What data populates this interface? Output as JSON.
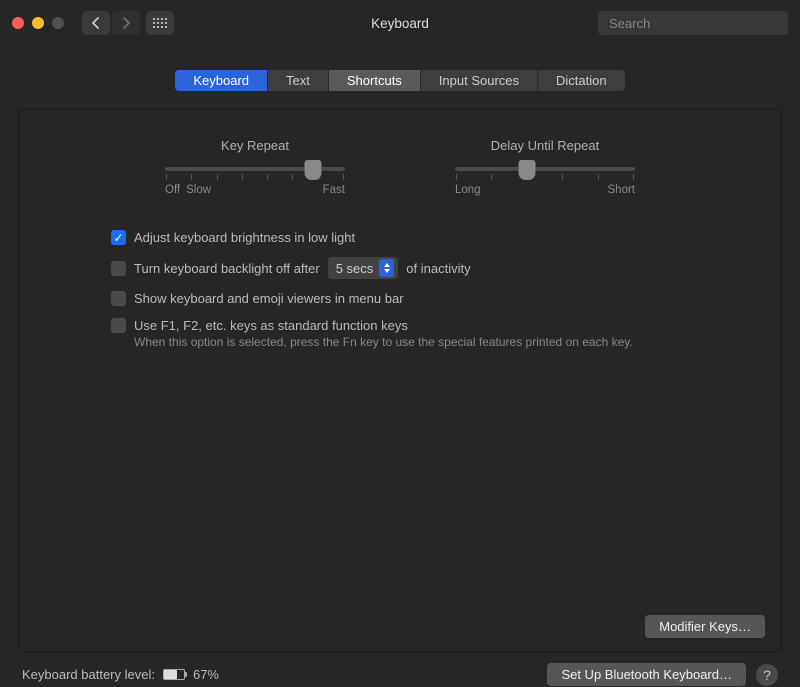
{
  "window": {
    "title": "Keyboard"
  },
  "search": {
    "placeholder": "Search"
  },
  "tabs": {
    "keyboard": "Keyboard",
    "text": "Text",
    "shortcuts": "Shortcuts",
    "input_sources": "Input Sources",
    "dictation": "Dictation"
  },
  "sliders": {
    "key_repeat": {
      "label": "Key Repeat",
      "left": "Off",
      "left2": "Slow",
      "right": "Fast",
      "position_pct": 82
    },
    "delay_repeat": {
      "label": "Delay Until Repeat",
      "left": "Long",
      "right": "Short",
      "position_pct": 40
    }
  },
  "options": {
    "brightness": {
      "checked": true,
      "label": "Adjust keyboard brightness in low light"
    },
    "backlight": {
      "checked": false,
      "label_pre": "Turn keyboard backlight off after",
      "dropdown": "5 secs",
      "label_post": "of inactivity"
    },
    "viewers": {
      "checked": false,
      "label": "Show keyboard and emoji viewers in menu bar"
    },
    "fkeys": {
      "checked": false,
      "label": "Use F1, F2, etc. keys as standard function keys",
      "help": "When this option is selected, press the Fn key to use the special features printed on each key."
    }
  },
  "buttons": {
    "modifier_keys": "Modifier Keys…",
    "bluetooth": "Set Up Bluetooth Keyboard…"
  },
  "footer": {
    "battery_label": "Keyboard battery level:",
    "battery_pct_text": "67%",
    "battery_fill_pct": 67
  }
}
